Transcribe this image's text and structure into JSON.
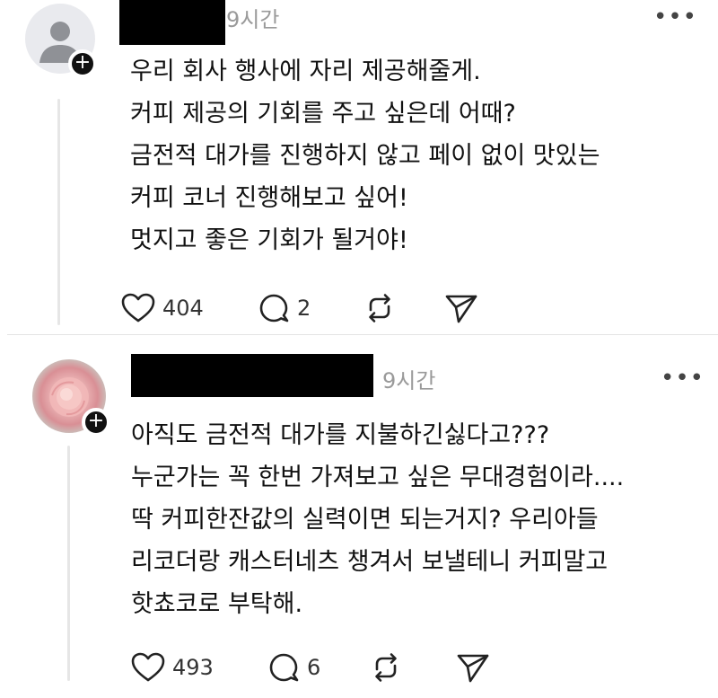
{
  "posts": [
    {
      "timestamp": "9시간",
      "more_label": "•••",
      "follow_label": "+",
      "body": [
        "우리 회사 행사에 자리 제공해줄게.",
        "커피 제공의 기회를 주고 싶은데 어때?",
        "금전적 대가를 진행하지 않고 페이 없이 맛있는",
        "커피 코너 진행해보고 싶어!",
        "멋지고 좋은 기회가 될거야!"
      ],
      "likes": "404",
      "replies": "2"
    },
    {
      "timestamp": "9시간",
      "more_label": "•••",
      "follow_label": "+",
      "body": [
        "아직도 금전적 대가를 지불하긴싫다고???",
        "누군가는 꼭 한번 가져보고 싶은 무대경험이라....",
        "딱 커피한잔값의 실력이면 되는거지? 우리아들",
        "리코더랑 캐스터네츠 챙겨서 보낼테니 커피말고",
        "핫쵸코로 부탁해."
      ],
      "likes": "493",
      "replies": "6"
    }
  ],
  "icons": {
    "like": "heart-icon",
    "reply": "comment-icon",
    "repost": "repost-icon",
    "share": "send-icon",
    "more": "more-icon"
  }
}
